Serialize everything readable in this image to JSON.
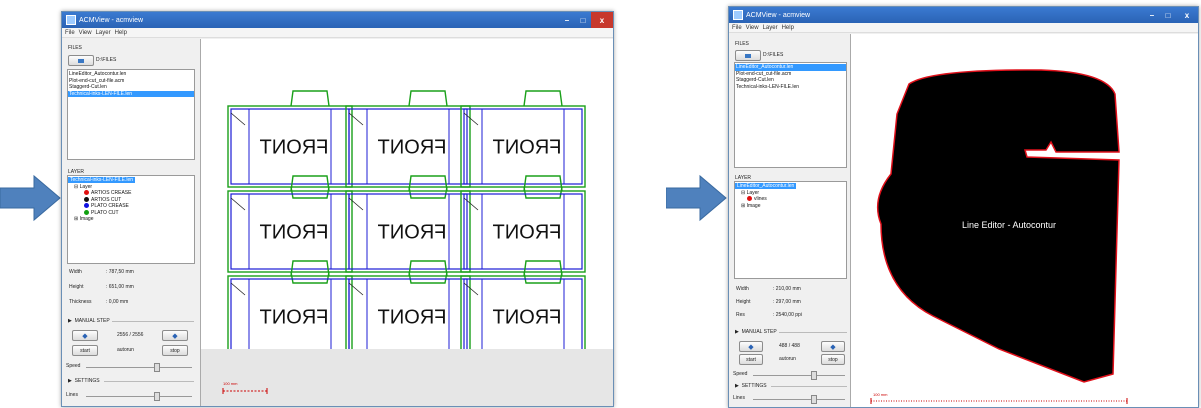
{
  "colors": {
    "arrow": "#4f81bd",
    "title_bar": "#2f6cc2",
    "selection": "#3399ff",
    "crease_line": "#1c1cd6",
    "cut_line": "#1aa01a",
    "scale_bar": "#cc0000",
    "shape_fill": "#000000",
    "shape_outline": "#e0101a"
  },
  "windows": [
    {
      "title": "ACMView - acmview",
      "menu": [
        "File",
        "View",
        "Layer",
        "Help"
      ],
      "files_heading": "FILES",
      "path": "D:\\FILES",
      "files": [
        "LineEditor_Autocontur.len",
        "Plot-end-cut_cut-file.acm",
        "Staggerd-Cut.len",
        "Technical-inks-LEN-FILE.len"
      ],
      "selected_file_index": 3,
      "layer_heading": "LAYER",
      "tree_root": "Technical-inks-LEN-FILE.len",
      "tree_layer": "Layer",
      "layers": [
        {
          "name": "ARTIOS CREASE",
          "color": "#e01010"
        },
        {
          "name": "ARTIOS CUT",
          "color": "#111111"
        },
        {
          "name": "PLATO CREASE",
          "color": "#1010e0"
        },
        {
          "name": "PLATO CUT",
          "color": "#10a010"
        }
      ],
      "tree_image": "Image",
      "props": [
        {
          "label": "Width",
          "value": ": 787,50 mm"
        },
        {
          "label": "Height",
          "value": ": 651,00 mm"
        },
        {
          "label": "Thickness",
          "value": ": 0,00 mm"
        }
      ],
      "manual_step": "MANUAL STEP",
      "step_counter": "2556 / 2556",
      "start": "start",
      "autorun": "autorun",
      "stop": "stop",
      "speed": "Speed",
      "settings": "SETTINGS",
      "lines": "Lines",
      "scale": "100 mm",
      "canvas_text": "FRONT",
      "speed_level": 0.88,
      "lines_level": 0.88
    },
    {
      "title": "ACMView - acmview",
      "menu": [
        "File",
        "View",
        "Layer",
        "Help"
      ],
      "files_heading": "FILES",
      "path": "D:\\FILES",
      "files": [
        "LineEditor_Autocontur.len",
        "Plot-end-cut_cut-file.acm",
        "Staggerd-Cut.len",
        "Technical-inks-LEN-FILE.len"
      ],
      "selected_file_index": 0,
      "layer_heading": "LAYER",
      "tree_root": "LineEditor_Autocontur.len",
      "tree_layer": "Layer",
      "layers": [
        {
          "name": "vlines",
          "color": "#e01010"
        }
      ],
      "tree_image": "Image",
      "props": [
        {
          "label": "Width",
          "value": ": 210,00 mm"
        },
        {
          "label": "Height",
          "value": ": 297,00 mm"
        },
        {
          "label": "Res",
          "value": ": 2540,00 ppi"
        }
      ],
      "manual_step": "MANUAL STEP",
      "step_counter": "488 / 488",
      "start": "start",
      "autorun": "autorun",
      "stop": "stop",
      "speed": "Speed",
      "settings": "SETTINGS",
      "lines": "Lines",
      "scale": "100 mm",
      "canvas_text": "Line Editor - Autocontur",
      "speed_level": 0.88,
      "lines_level": 0.88
    }
  ]
}
